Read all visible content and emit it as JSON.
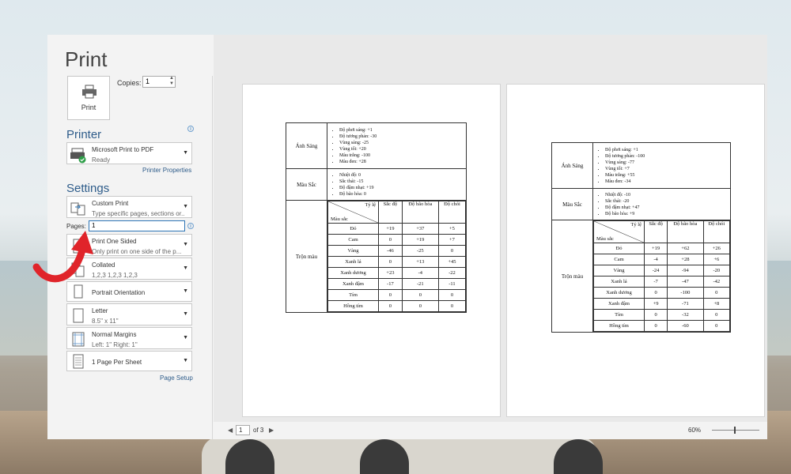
{
  "title": "Print",
  "print_button": {
    "label": "Print",
    "icon": "printer-icon"
  },
  "copies": {
    "label": "Copies:",
    "value": "1"
  },
  "printer": {
    "section": "Printer",
    "name": "Microsoft Print to PDF",
    "status": "Ready",
    "properties_link": "Printer Properties"
  },
  "settings": {
    "section": "Settings",
    "items": [
      {
        "l1": "Custom Print",
        "l2": "Type specific pages, sections or...",
        "icon": "custom-print-icon"
      },
      {
        "l1": "Print One Sided",
        "l2": "Only print on one side of the p...",
        "icon": "one-sided-icon"
      },
      {
        "l1": "Collated",
        "l2": "1,2,3    1,2,3    1,2,3",
        "icon": "collated-icon"
      },
      {
        "l1": "Portrait Orientation",
        "l2": "",
        "icon": "portrait-icon"
      },
      {
        "l1": "Letter",
        "l2": "8.5\" x 11\"",
        "icon": "paper-icon"
      },
      {
        "l1": "Normal Margins",
        "l2": "Left:  1\"    Right:  1\"",
        "icon": "margins-icon"
      },
      {
        "l1": "1 Page Per Sheet",
        "l2": "",
        "icon": "pages-per-sheet-icon"
      }
    ],
    "page_setup_link": "Page Setup"
  },
  "pages": {
    "label": "Pages:",
    "value": "1"
  },
  "navigation": {
    "current": "1",
    "of_label": "of 3"
  },
  "zoom": {
    "label": "60%"
  },
  "sheet1": {
    "anh_sang": {
      "label": "Ánh Sáng",
      "items": [
        "Độ phơi sáng: +1",
        "Độ tương phản: -30",
        "Vùng sáng: -25",
        "Vùng tối: +20",
        "Màu trắng: -100",
        "Màu đen: +28"
      ]
    },
    "mau_sac": {
      "label": "Màu Sắc",
      "items": [
        "Nhiệt độ: 0",
        "Sắc thái: -15",
        "Độ đậm nhạt: +19",
        "Độ bão hòa: 0"
      ]
    },
    "tron_mau": {
      "label": "Trộn màu",
      "corner_top": "Tỷ lệ",
      "corner_bottom": "Màu sắc",
      "headers": [
        "Sắc độ",
        "Độ bão hòa",
        "Độ chói"
      ],
      "rows": [
        {
          "name": "Đỏ",
          "v": [
            "+19",
            "+37",
            "+5"
          ]
        },
        {
          "name": "Cam",
          "v": [
            "0",
            "+19",
            "+7"
          ]
        },
        {
          "name": "Vàng",
          "v": [
            "-46",
            "-25",
            "0"
          ]
        },
        {
          "name": "Xanh lá",
          "v": [
            "0",
            "+13",
            "+45"
          ]
        },
        {
          "name": "Xanh dương",
          "v": [
            "+23",
            "-4",
            "-22"
          ]
        },
        {
          "name": "Xanh đậm",
          "v": [
            "-17",
            "-21",
            "-11"
          ]
        },
        {
          "name": "Tím",
          "v": [
            "0",
            "0",
            "0"
          ]
        },
        {
          "name": "Hồng tím",
          "v": [
            "0",
            "0",
            "0"
          ]
        }
      ]
    }
  },
  "sheet2": {
    "anh_sang": {
      "label": "Ánh Sáng",
      "items": [
        "Độ phơi sáng: +1",
        "Độ tương phản: -100",
        "Vùng sáng: -77",
        "Vùng tối: +7",
        "Màu trắng: +55",
        "Màu đen: -34"
      ]
    },
    "mau_sac": {
      "label": "Màu Sắc",
      "items": [
        "Nhiệt độ: -10",
        "Sắc thái: -20",
        "Độ đậm nhạt: +47",
        "Độ bão hòa: +9"
      ]
    },
    "tron_mau": {
      "label": "Trộn màu",
      "corner_top": "Tỷ lệ",
      "corner_bottom": "Màu sắc",
      "headers": [
        "Sắc độ",
        "Độ bão hòa",
        "Độ chói"
      ],
      "rows": [
        {
          "name": "Đỏ",
          "v": [
            "+19",
            "+62",
            "+26"
          ]
        },
        {
          "name": "Cam",
          "v": [
            "-4",
            "+28",
            "+6"
          ]
        },
        {
          "name": "Vàng",
          "v": [
            "-24",
            "-94",
            "-20"
          ]
        },
        {
          "name": "Xanh lá",
          "v": [
            "-7",
            "-47",
            "-42"
          ]
        },
        {
          "name": "Xanh dương",
          "v": [
            "0",
            "-100",
            "0"
          ]
        },
        {
          "name": "Xanh đậm",
          "v": [
            "+9",
            "-71",
            "+8"
          ]
        },
        {
          "name": "Tím",
          "v": [
            "0",
            "-32",
            "0"
          ]
        },
        {
          "name": "Hồng tím",
          "v": [
            "0",
            "-60",
            "0"
          ]
        }
      ]
    }
  },
  "colors": {
    "accent": "#2e5c8a",
    "arrow": "#e0242a"
  }
}
